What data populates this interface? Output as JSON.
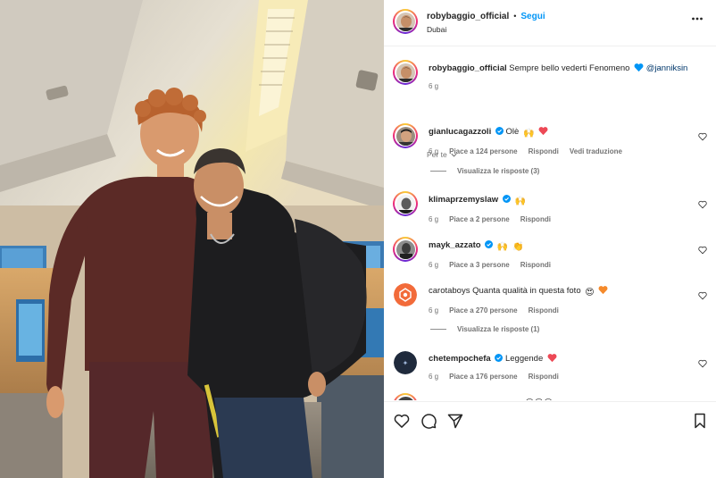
{
  "post": {
    "username": "robybaggio_official",
    "follow_label": "Segui",
    "location": "Dubai",
    "more_icon": "more-horizontal-icon"
  },
  "caption": {
    "username": "robybaggio_official",
    "text": "Sempre bello vederti Fenomeno",
    "mention": "@janniksin",
    "time": "6 g"
  },
  "sort": {
    "label": "Per te"
  },
  "comments": [
    {
      "username": "gianlucagazzoli",
      "verified": true,
      "text": "Olè",
      "time": "6 g",
      "likes": "Piace a 124 persone",
      "reply": "Rispondi",
      "translate": "Vedi traduzione"
    },
    {
      "username": "klimaprzemyslaw",
      "verified": true,
      "text": "",
      "time": "6 g",
      "likes": "Piace a 2 persone",
      "reply": "Rispondi"
    },
    {
      "username": "mayk_azzato",
      "verified": true,
      "text": "",
      "time": "6 g",
      "likes": "Piace a 3 persone",
      "reply": "Rispondi"
    },
    {
      "username": "carotaboys",
      "verified": false,
      "text": "Quanta qualità in questa foto",
      "time": "6 g",
      "likes": "Piace a 270 persone",
      "reply": "Rispondi"
    },
    {
      "username": "chetempochefa",
      "verified": true,
      "text": "Leggende",
      "time": "6 g",
      "likes": "Piace a 176 persone",
      "reply": "Rispondi"
    }
  ],
  "view_replies": [
    {
      "label": "Visualizza le risposte (3)"
    },
    {
      "label": "Visualizza le risposte (1)"
    }
  ],
  "colors": {
    "accent": "#0095f6",
    "verified": "#0095f6",
    "muted": "#737373",
    "heart_red": "#ed4956"
  }
}
